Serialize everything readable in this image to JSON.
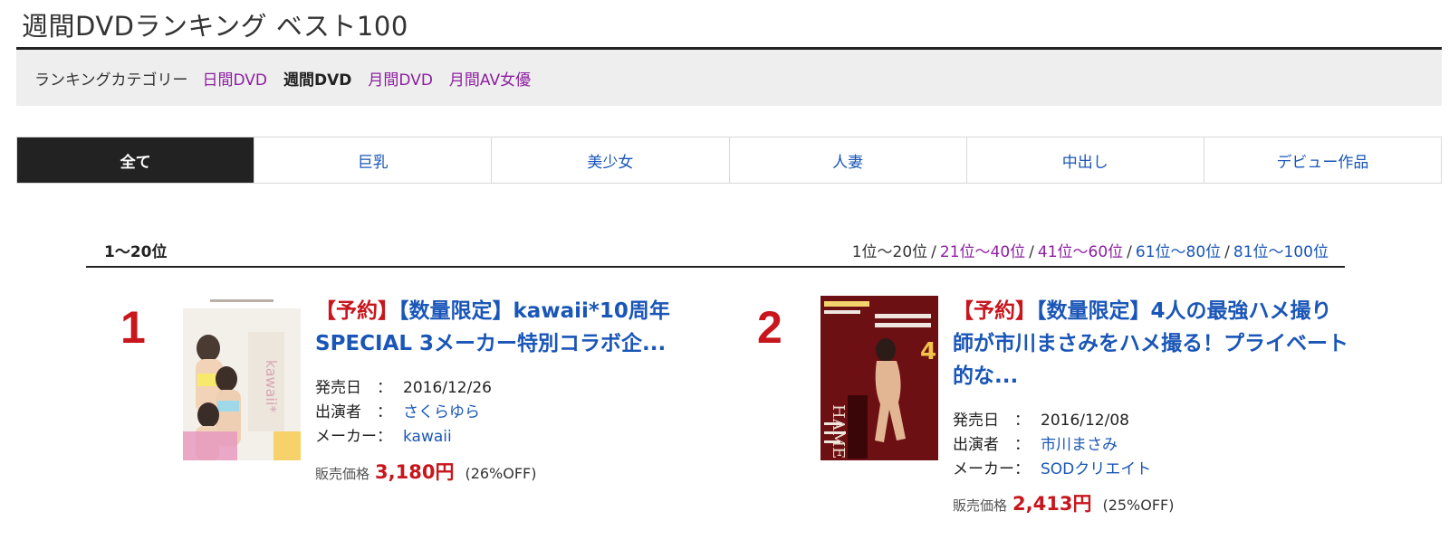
{
  "page": {
    "title": "週間DVDランキング ベスト100"
  },
  "category_bar": {
    "label": "ランキングカテゴリー",
    "items": [
      {
        "label": "日間DVD",
        "active": false
      },
      {
        "label": "週間DVD",
        "active": true
      },
      {
        "label": "月間DVD",
        "active": false
      },
      {
        "label": "月間AV女優",
        "active": false
      }
    ]
  },
  "tabs": [
    {
      "label": "全て",
      "active": true
    },
    {
      "label": "巨乳",
      "active": false
    },
    {
      "label": "美少女",
      "active": false
    },
    {
      "label": "人妻",
      "active": false
    },
    {
      "label": "中出し",
      "active": false
    },
    {
      "label": "デビュー作品",
      "active": false
    }
  ],
  "range": {
    "current_label": "1〜20位",
    "nav": [
      "1位〜20位",
      "21位〜40位",
      "41位〜60位",
      "61位〜80位",
      "81位〜100位"
    ],
    "separator": "/"
  },
  "items": [
    {
      "rank": "1",
      "title_prefix": "【予約】",
      "title": "【数量限定】kawaii*10周年SPECIAL 3メーカー特別コラボ企...",
      "release_label": "発売日",
      "release": "2016/12/26",
      "cast_label": "出演者",
      "cast": "さくらゆら",
      "maker_label": "メーカー",
      "maker": "kawaii",
      "price_label": "販売価格",
      "price": "3,180円",
      "discount": "(26%OFF)"
    },
    {
      "rank": "2",
      "title_prefix": "【予約】",
      "title": "【数量限定】4人の最強ハメ撮り師が市川まさみをハメ撮る！プライベート的な...",
      "release_label": "発売日",
      "release": "2016/12/08",
      "cast_label": "出演者",
      "cast": "市川まさみ",
      "maker_label": "メーカー",
      "maker": "SODクリエイト",
      "price_label": "販売価格",
      "price": "2,413円",
      "discount": "(25%OFF)"
    }
  ],
  "colors": {
    "accent_red": "#c8161d",
    "link_blue": "#1a56b7",
    "visited_purple": "#8d1fa0",
    "active_tab_bg": "#222222"
  }
}
